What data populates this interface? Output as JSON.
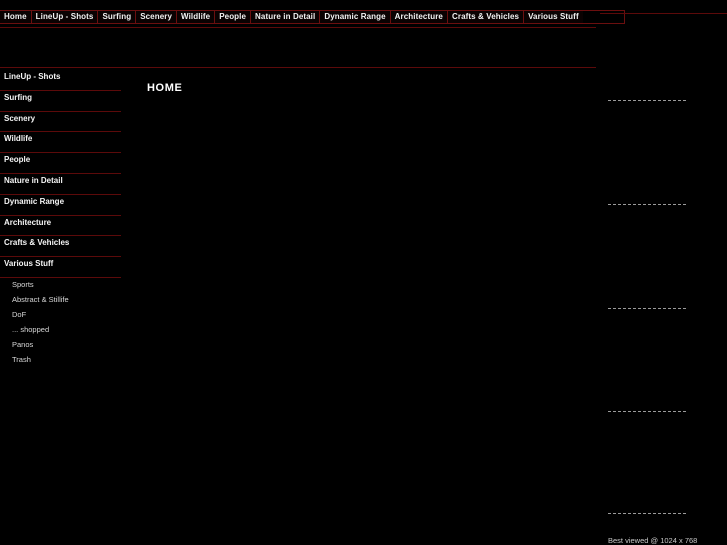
{
  "site": {
    "background_color": "#000000",
    "accent_color": "#5c0a0a",
    "text_color": "#f2f2f2"
  },
  "topnav": {
    "items": [
      {
        "label": "Home"
      },
      {
        "label": "LineUp - Shots"
      },
      {
        "label": "Surfing"
      },
      {
        "label": "Scenery"
      },
      {
        "label": "Wildlife"
      },
      {
        "label": "People"
      },
      {
        "label": "Nature in Detail"
      },
      {
        "label": "Dynamic Range"
      },
      {
        "label": "Architecture"
      },
      {
        "label": "Crafts & Vehicles"
      },
      {
        "label": "Various Stuff"
      }
    ]
  },
  "sidebar": {
    "items": [
      {
        "label": "LineUp - Shots"
      },
      {
        "label": "Surfing"
      },
      {
        "label": "Scenery"
      },
      {
        "label": "Wildlife"
      },
      {
        "label": "People"
      },
      {
        "label": "Nature in Detail"
      },
      {
        "label": "Dynamic Range"
      },
      {
        "label": "Architecture"
      },
      {
        "label": "Crafts & Vehicles"
      },
      {
        "label": "Various Stuff"
      }
    ],
    "subitems": [
      {
        "label": "Sports"
      },
      {
        "label": "Abstract & Stillife"
      },
      {
        "label": "DoF"
      },
      {
        "label": "... shopped"
      },
      {
        "label": "Panos"
      },
      {
        "label": "Trash"
      }
    ]
  },
  "main": {
    "title": "HOME"
  },
  "rightcol": {
    "separators": [
      100,
      204,
      308,
      411,
      513
    ],
    "footer_note": "Best viewed @ 1024 x 768"
  }
}
